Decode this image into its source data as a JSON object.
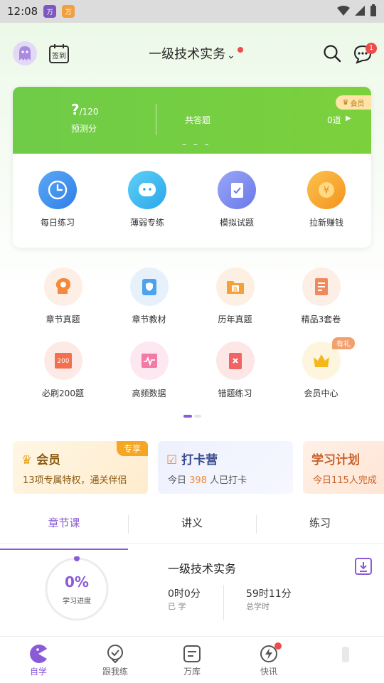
{
  "status_bar": {
    "time": "12:08"
  },
  "header": {
    "title": "一级技术实务",
    "signin_label": "签到",
    "message_count": "1"
  },
  "score_card": {
    "score_value": "?",
    "score_total": "/120",
    "score_label": "预测分",
    "total_label": "共答题",
    "total_value": "0道",
    "vip_tag": "会员",
    "placeholder_dashes": "– – –"
  },
  "quick_actions": [
    {
      "label": "每日练习",
      "icon": "clock-icon",
      "color": "#3d8ff0"
    },
    {
      "label": "薄弱专练",
      "icon": "chat-face-icon",
      "color": "#35b6ef"
    },
    {
      "label": "模拟试题",
      "icon": "exam-paper-icon",
      "color": "#7e8cf0"
    },
    {
      "label": "拉新赚钱",
      "icon": "yuan-coin-icon",
      "color": "#f5a02b"
    }
  ],
  "grid": [
    {
      "label": "章节真题",
      "icon": "brain-gear-icon"
    },
    {
      "label": "章节教材",
      "icon": "shield-book-icon"
    },
    {
      "label": "历年真题",
      "icon": "folder-zhen-icon"
    },
    {
      "label": "精品3套卷",
      "icon": "document-list-icon"
    },
    {
      "label": "必刷200题",
      "icon": "book-200-icon"
    },
    {
      "label": "高频数据",
      "icon": "pulse-chart-icon"
    },
    {
      "label": "错题练习",
      "icon": "error-book-icon"
    },
    {
      "label": "会员中心",
      "icon": "crown-icon",
      "tag": "有礼"
    }
  ],
  "banners": {
    "vip": {
      "title": "会员",
      "tag": "专享",
      "subtitle": "13项专属特权，通关伴侣"
    },
    "checkin": {
      "title": "打卡营",
      "subtitle_prefix": "今日",
      "count": "398",
      "subtitle_suffix": "人已打卡"
    },
    "plan": {
      "title": "学习计划",
      "subtitle": "今日115人完成"
    }
  },
  "tabs": [
    "章节课",
    "讲义",
    "练习"
  ],
  "course": {
    "progress_pct": "0%",
    "progress_label": "学习进度",
    "title": "一级技术实务",
    "studied_value": "0时0分",
    "studied_label": "已 学",
    "total_value": "59时11分",
    "total_label": "总学时"
  },
  "bottom_nav": [
    {
      "label": "自学",
      "icon": "pacman-icon"
    },
    {
      "label": "跟我练",
      "icon": "check-badge-icon"
    },
    {
      "label": "万库",
      "icon": "list-doc-icon"
    },
    {
      "label": "快讯",
      "icon": "lightning-icon"
    }
  ],
  "colors": {
    "accent": "#8a5bd6",
    "green": "#6fcc48",
    "red_dot": "#f04b4b"
  }
}
